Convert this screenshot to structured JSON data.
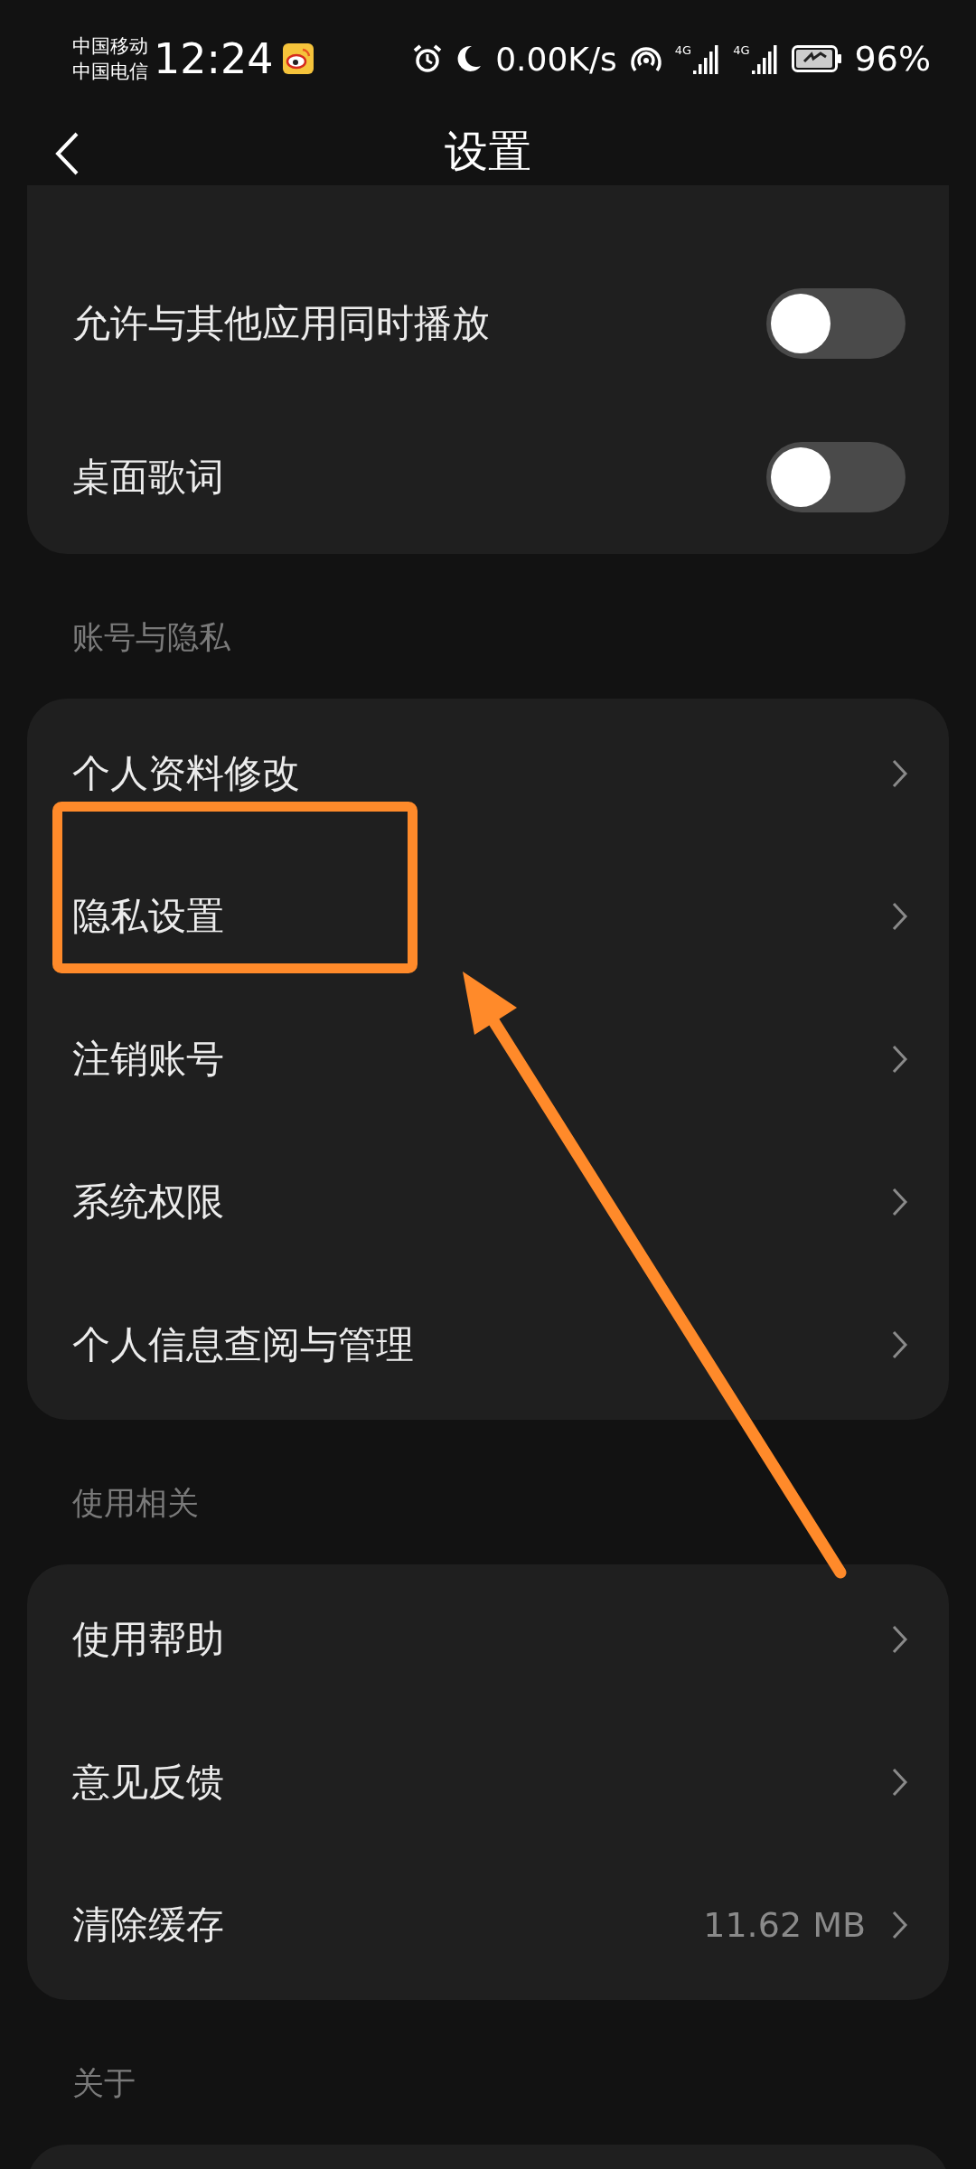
{
  "status_bar": {
    "carriers": [
      "中国移动",
      "中国电信"
    ],
    "time": "12:24",
    "speed": "0.00K/s",
    "signals": [
      "4G",
      "4G"
    ],
    "battery": "96%"
  },
  "header": {
    "title": "设置"
  },
  "sections": [
    {
      "items": [
        {
          "kind": "toggle",
          "label": "允许与其他应用同时播放",
          "on": false
        },
        {
          "kind": "toggle",
          "label": "桌面歌词",
          "on": false
        }
      ]
    },
    {
      "title": "账号与隐私",
      "items": [
        {
          "kind": "link",
          "label": "个人资料修改",
          "highlight": false
        },
        {
          "kind": "link",
          "label": "隐私设置",
          "highlight": true
        },
        {
          "kind": "link",
          "label": "注销账号",
          "highlight": false
        },
        {
          "kind": "link",
          "label": "系统权限",
          "highlight": false
        },
        {
          "kind": "link",
          "label": "个人信息查阅与管理",
          "highlight": false
        }
      ]
    },
    {
      "title": "使用相关",
      "items": [
        {
          "kind": "link",
          "label": "使用帮助",
          "highlight": false
        },
        {
          "kind": "link",
          "label": "意见反馈",
          "highlight": false
        },
        {
          "kind": "link",
          "label": "清除缓存",
          "value": "11.62 MB",
          "highlight": false
        }
      ]
    },
    {
      "title": "关于"
    }
  ]
}
